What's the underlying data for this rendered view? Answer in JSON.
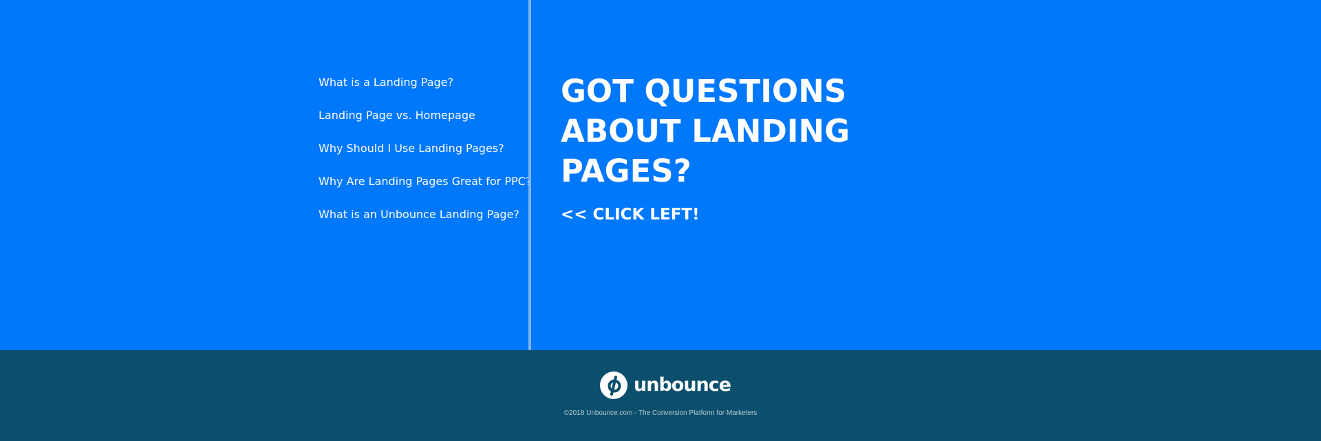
{
  "nav": {
    "items": [
      {
        "label": "What is a Landing Page?"
      },
      {
        "label": "Landing Page vs. Homepage"
      },
      {
        "label": "Why Should I Use Landing Pages?"
      },
      {
        "label": "Why Are Landing Pages Great for PPC?"
      },
      {
        "label": "What is an Unbounce Landing Page?"
      }
    ]
  },
  "hero": {
    "headline": "GOT QUESTIONS ABOUT LANDING PAGES?",
    "cta": "<< CLICK LEFT!"
  },
  "footer": {
    "logo_text": "unbounce",
    "logo_icon": "unbounce-logo-icon",
    "copyright": "©2018 Unbounce.com - The Conversion Platform for Marketers"
  },
  "colors": {
    "main_background": "#0078fc",
    "divider": "#7db4f3",
    "footer_background": "#0b4f6c",
    "text": "#ffffff",
    "footer_text": "#b9cbd6"
  }
}
